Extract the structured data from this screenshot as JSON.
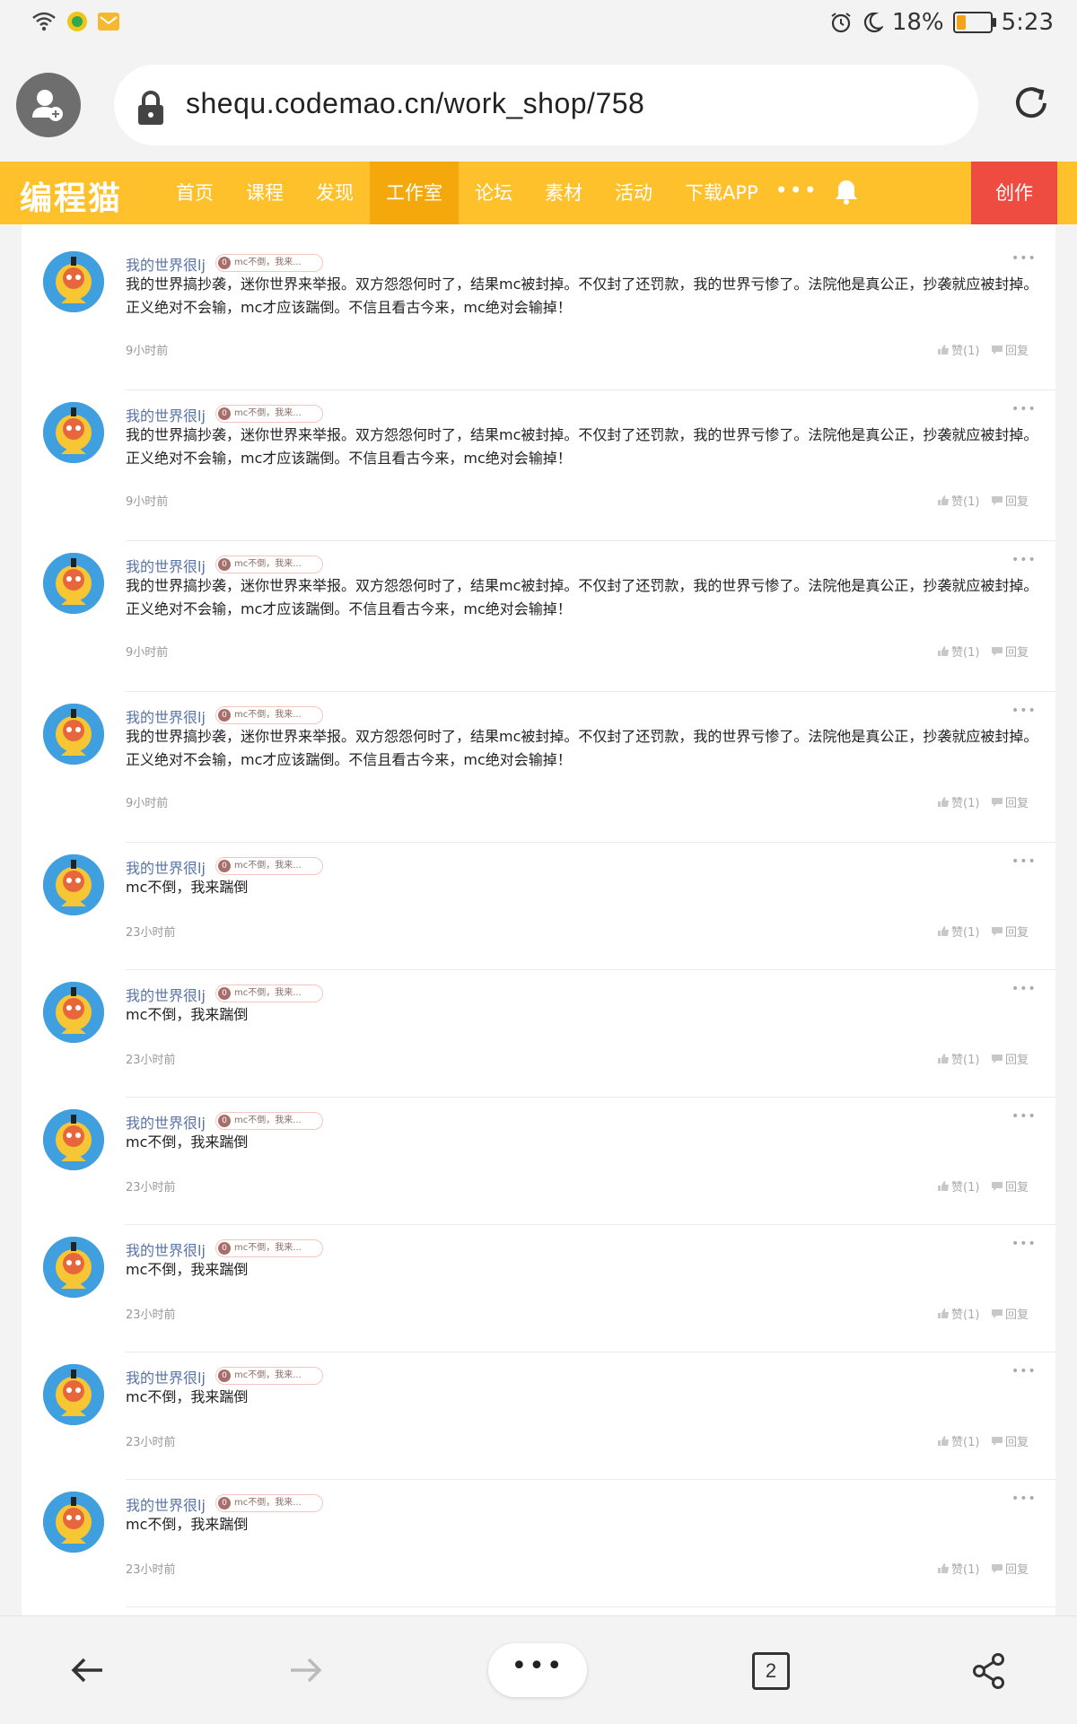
{
  "status": {
    "battery_percent": "18%",
    "time": "5:23"
  },
  "browser": {
    "url": "shequ.codemao.cn/work_shop/758",
    "tab_count": "2",
    "menu_label": "•••"
  },
  "site": {
    "logo": "编程猫",
    "nav": [
      "首页",
      "课程",
      "发现",
      "工作室",
      "论坛",
      "素材",
      "活动",
      "下载APP"
    ],
    "active_nav": "工作室",
    "more": "•••",
    "create_label": "创作"
  },
  "comments": [
    {
      "user": "我的世界很lj",
      "badge_level": "0",
      "badge": "mc不倒，我来...",
      "text": "我的世界搞抄袭，迷你世界来举报。双方怨怨何时了，结果mc被封掉。不仅封了还罚款，我的世界亏惨了。法院他是真公正，抄袭就应被封掉。正义绝对不会输，mc才应该踹倒。不信且看古今来，mc绝对会输掉！",
      "time": "9小时前",
      "like": "赞(1)",
      "reply": "回复"
    },
    {
      "user": "我的世界很lj",
      "badge_level": "0",
      "badge": "mc不倒，我来...",
      "text": "我的世界搞抄袭，迷你世界来举报。双方怨怨何时了，结果mc被封掉。不仅封了还罚款，我的世界亏惨了。法院他是真公正，抄袭就应被封掉。正义绝对不会输，mc才应该踹倒。不信且看古今来，mc绝对会输掉！",
      "time": "9小时前",
      "like": "赞(1)",
      "reply": "回复"
    },
    {
      "user": "我的世界很lj",
      "badge_level": "0",
      "badge": "mc不倒，我来...",
      "text": "我的世界搞抄袭，迷你世界来举报。双方怨怨何时了，结果mc被封掉。不仅封了还罚款，我的世界亏惨了。法院他是真公正，抄袭就应被封掉。正义绝对不会输，mc才应该踹倒。不信且看古今来，mc绝对会输掉！",
      "time": "9小时前",
      "like": "赞(1)",
      "reply": "回复"
    },
    {
      "user": "我的世界很lj",
      "badge_level": "0",
      "badge": "mc不倒，我来...",
      "text": "我的世界搞抄袭，迷你世界来举报。双方怨怨何时了，结果mc被封掉。不仅封了还罚款，我的世界亏惨了。法院他是真公正，抄袭就应被封掉。正义绝对不会输，mc才应该踹倒。不信且看古今来，mc绝对会输掉！",
      "time": "9小时前",
      "like": "赞(1)",
      "reply": "回复"
    },
    {
      "user": "我的世界很lj",
      "badge_level": "0",
      "badge": "mc不倒，我来...",
      "text": "mc不倒，我来踹倒",
      "time": "23小时前",
      "like": "赞(1)",
      "reply": "回复"
    },
    {
      "user": "我的世界很lj",
      "badge_level": "0",
      "badge": "mc不倒，我来...",
      "text": "mc不倒，我来踹倒",
      "time": "23小时前",
      "like": "赞(1)",
      "reply": "回复"
    },
    {
      "user": "我的世界很lj",
      "badge_level": "0",
      "badge": "mc不倒，我来...",
      "text": "mc不倒，我来踹倒",
      "time": "23小时前",
      "like": "赞(1)",
      "reply": "回复"
    },
    {
      "user": "我的世界很lj",
      "badge_level": "0",
      "badge": "mc不倒，我来...",
      "text": "mc不倒，我来踹倒",
      "time": "23小时前",
      "like": "赞(1)",
      "reply": "回复"
    },
    {
      "user": "我的世界很lj",
      "badge_level": "0",
      "badge": "mc不倒，我来...",
      "text": "mc不倒，我来踹倒",
      "time": "23小时前",
      "like": "赞(1)",
      "reply": "回复"
    },
    {
      "user": "我的世界很lj",
      "badge_level": "0",
      "badge": "mc不倒，我来...",
      "text": "mc不倒，我来踹倒",
      "time": "23小时前",
      "like": "赞(1)",
      "reply": "回复"
    }
  ],
  "colors": {
    "nav_bg": "#ffc12b",
    "nav_active": "#f4a80c",
    "create_bg": "#ee4b41",
    "username": "#5873a6"
  },
  "icons": [
    "wifi-icon",
    "app-icon",
    "mail-icon",
    "alarm-icon",
    "moon-icon",
    "battery-icon",
    "profile-icon",
    "lock-icon",
    "reload-icon",
    "bell-icon",
    "more-icon",
    "thumb-up-icon",
    "reply-icon",
    "back-icon",
    "forward-icon",
    "share-icon"
  ]
}
